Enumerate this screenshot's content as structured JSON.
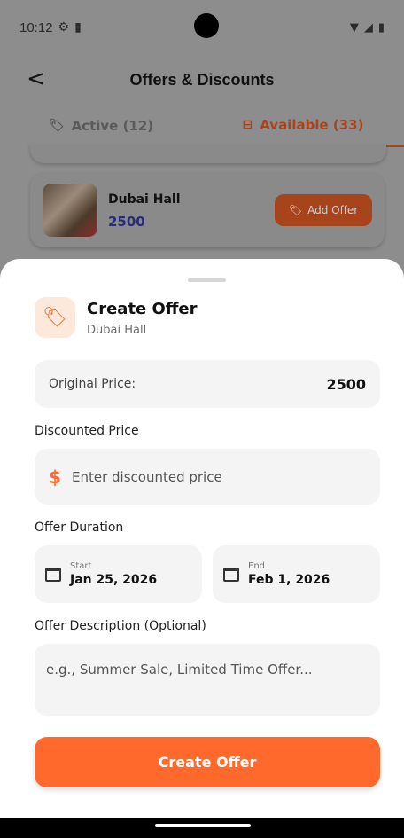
{
  "status_bar": {
    "time": "10:12"
  },
  "app_bar": {
    "title": "Offers & Discounts"
  },
  "tabs": [
    {
      "label": "Active (12)",
      "icon": "tag-icon"
    },
    {
      "label": "Available (33)",
      "icon": "archive-icon"
    }
  ],
  "venue_card": {
    "name": "Dubai Hall",
    "price": "2500",
    "button_label": "Add Offer"
  },
  "sheet": {
    "title": "Create Offer",
    "subtitle": "Dubai Hall",
    "original_price_label": "Original Price:",
    "original_price_value": "2500",
    "discounted_price_label": "Discounted Price",
    "discounted_price_placeholder": "Enter discounted price",
    "currency_symbol": "$",
    "offer_duration_label": "Offer Duration",
    "start_label": "Start",
    "start_date": "Jan 25, 2026",
    "end_label": "End",
    "end_date": "Feb 1, 2026",
    "description_label": "Offer Description (Optional)",
    "description_placeholder": "e.g., Summer Sale, Limited Time Offer...",
    "create_button": "Create Offer"
  },
  "colors": {
    "accent": "#ff6a2c",
    "accent_light": "#fde8dc",
    "price_text": "#2b2a7a"
  }
}
